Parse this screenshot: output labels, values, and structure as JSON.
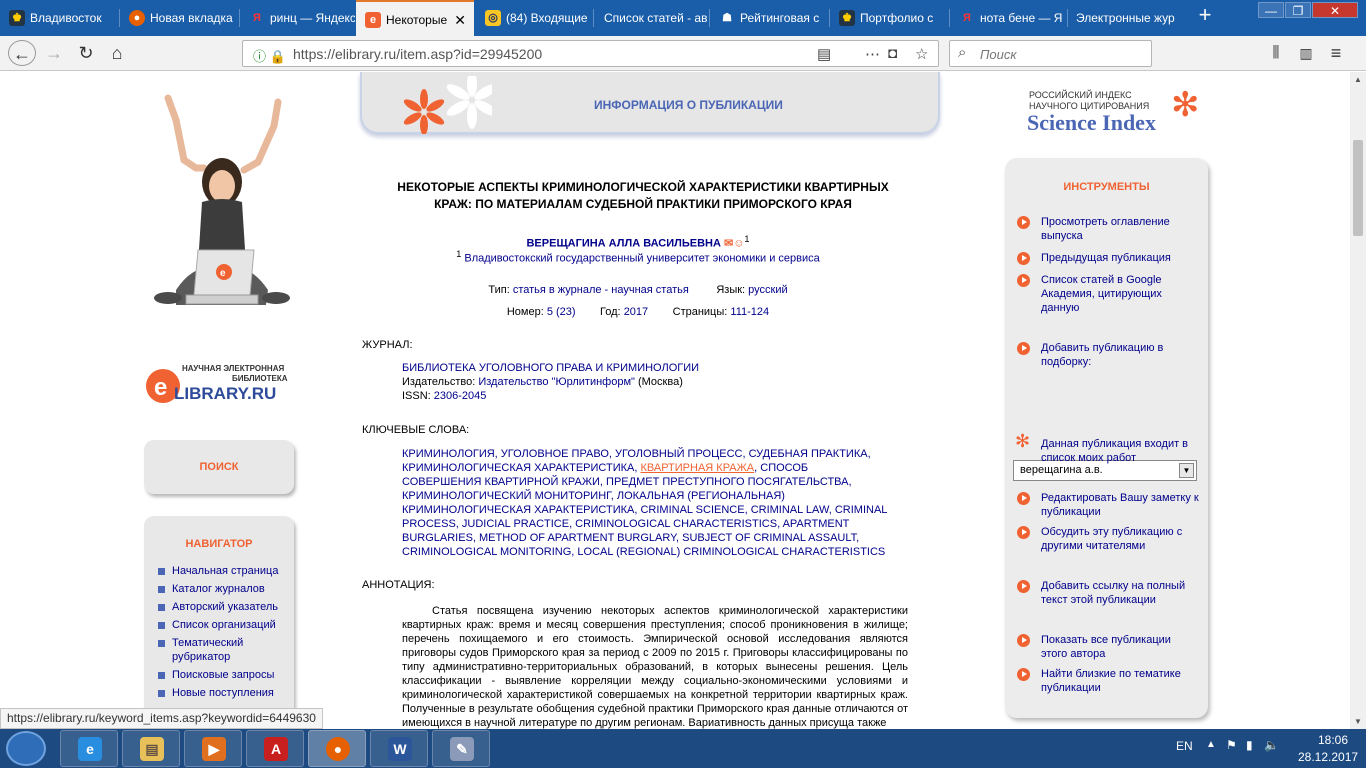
{
  "browser": {
    "tabs": [
      {
        "label": "Владивосток",
        "icon": "eagle-icon"
      },
      {
        "label": "Новая вкладка",
        "icon": "firefox-icon"
      },
      {
        "label": "ринц — Яндекс",
        "icon": "yandex-icon"
      },
      {
        "label": "Некоторые",
        "icon": "elibrary-icon",
        "active": true
      },
      {
        "label": "(84) Входящие",
        "icon": "mail-icon"
      },
      {
        "label": "Список статей - ав",
        "icon": ""
      },
      {
        "label": "Рейтинговая с",
        "icon": "people-icon"
      },
      {
        "label": "Портфолио с",
        "icon": "eagle-icon"
      },
      {
        "label": "нота бене — Я",
        "icon": "yandex-icon"
      },
      {
        "label": "Электронные жур",
        "icon": ""
      }
    ],
    "url": "https://elibrary.ru/item.asp?id=29945200",
    "search_placeholder": "Поиск",
    "status_url": "https://elibrary.ru/keyword_items.asp?keywordid=6449630"
  },
  "header": {
    "info_title": "ИНФОРМАЦИЯ О ПУБЛИКАЦИИ",
    "sci_line1": "РОССИЙСКИЙ ИНДЕКС",
    "sci_line2": "НАУЧНОГО ЦИТИРОВАНИЯ",
    "sci_title": "Science Index"
  },
  "left": {
    "logo_line1": "НАУЧНАЯ ЭЛЕКТРОННАЯ",
    "logo_line2": "БИБЛИОТЕКА",
    "logo_brand": "LIBRARY.RU",
    "search_label": "ПОИСК",
    "navigator_label": "НАВИГАТОР",
    "nav_items": [
      "Начальная страница",
      "Каталог журналов",
      "Авторский указатель",
      "Список организаций",
      "Тематический рубрикатор",
      "Поисковые запросы",
      "Новые поступления"
    ]
  },
  "article": {
    "title": "НЕКОТОРЫЕ АСПЕКТЫ КРИМИНОЛОГИЧЕСКОЙ ХАРАКТЕРИСТИКИ КВАРТИРНЫХ КРАЖ: ПО МАТЕРИАЛАМ СУДЕБНОЙ ПРАКТИКИ ПРИМОРСКОГО КРАЯ",
    "author": "ВЕРЕЩАГИНА АЛЛА ВАСИЛЬЕВНА",
    "author_sup": "1",
    "affil_sup": "1",
    "affiliation": "Владивостокский государственный университет экономики и сервиса",
    "type_label": "Тип:",
    "type_value": "статья в журнале - научная статья",
    "lang_label": "Язык:",
    "lang_value": "русский",
    "num_label": "Номер:",
    "num_value": "5 (23)",
    "year_label": "Год:",
    "year_value": "2017",
    "pages_label": "Страницы:",
    "pages_value": "111-124",
    "journal_label": "ЖУРНАЛ:",
    "journal_name": "БИБЛИОТЕКА УГОЛОВНОГО ПРАВА И КРИМИНОЛОГИИ",
    "publisher_label": "Издательство:",
    "publisher_value": "Издательство \"Юрлитинформ\"",
    "publisher_city": "(Москва)",
    "issn_label": "ISSN:",
    "issn_value": "2306-2045",
    "keywords_label": "КЛЮЧЕВЫЕ СЛОВА:",
    "keywords_before": "КРИМИНОЛОГИЯ, УГОЛОВНОЕ ПРАВО, УГОЛОВНЫЙ ПРОЦЕСС, СУДЕБНАЯ ПРАКТИКА, КРИМИНОЛОГИЧЕСКАЯ ХАРАКТЕРИСТИКА,",
    "keywords_hover": "КВАРТИРНАЯ КРАЖА",
    "keywords_after": ", СПОСОБ СОВЕРШЕНИЯ КВАРТИРНОЙ КРАЖИ, ПРЕДМЕТ ПРЕСТУПНОГО ПОСЯГАТЕЛЬСТВА, КРИМИНОЛОГИЧЕСКИЙ МОНИТОРИНГ, ЛОКАЛЬНАЯ (РЕГИОНАЛЬНАЯ) КРИМИНОЛОГИЧЕСКАЯ ХАРАКТЕРИСТИКА, CRIMINAL SCIENCE, CRIMINAL LAW, CRIMINAL PROCESS, JUDICIAL PRACTICE, CRIMINOLOGICAL CHARACTERISTICS, APARTMENT BURGLARIES, METHOD OF APARTMENT BURGLARY, SUBJECT OF CRIMINAL ASSAULT, CRIMINOLOGICAL MONITORING, LOCAL (REGIONAL) CRIMINOLOGICAL CHARACTERISTICS",
    "abstract_label": "АННОТАЦИЯ:",
    "abstract": "Статья посвящена изучению некоторых аспектов криминологической характеристики квартирных краж: время и месяц совершения преступления; способ проникновения в жилище; перечень похищаемого и его стоимость. Эмпирической основой исследования являются приговоры судов Приморского края за период с 2009 по 2015 г. Приговоры классифицированы по типу административно-территориальных образований, в которых вынесены решения. Цель классификации - выявление корреляции между социально-экономическими условиями и криминологической характеристикой совершаемых на конкретной территории квартирных краж. Полученные в результате обобщения судебной практики Приморского края данные отличаются от имеющихся в научной литературе по другим регионам. Вариативность данных присуща также"
  },
  "tools": {
    "title": "ИНСТРУМЕНТЫ",
    "items": [
      "Просмотреть оглавление выпуска",
      "Предыдущая публикация",
      "Список статей в Google Академия, цитирующих данную",
      "Добавить публикацию в подборку:",
      "Данная публикация входит в список моих работ",
      "Редактировать Вашу заметку к публикации",
      "Обсудить эту публикацию с другими читателями",
      "Добавить ссылку на полный текст этой публикации",
      "Показать все публикации этого автора",
      "Найти близкие по тематике публикации"
    ],
    "select_value": "верещагина а.в."
  },
  "taskbar": {
    "lang": "EN",
    "time": "18:06",
    "date": "28.12.2017"
  },
  "colors": {
    "accent": "#f06232",
    "link": "#00008b",
    "header_blue": "#4a66b5",
    "tabbar": "#1a5da8"
  }
}
